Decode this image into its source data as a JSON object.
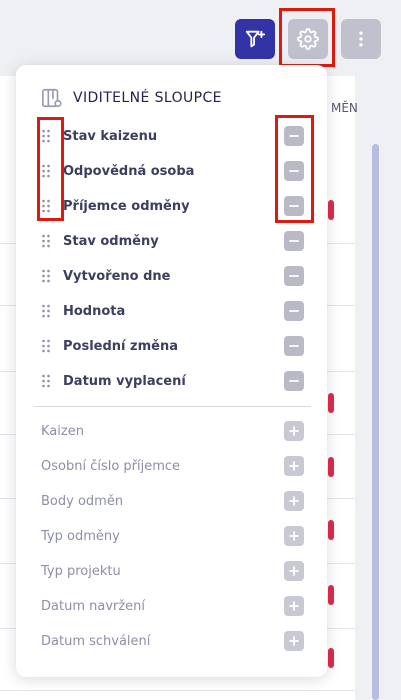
{
  "table": {
    "partial_header": "MĚN"
  },
  "toolbar": {
    "filter_icon": "filter-plus-icon",
    "settings_icon": "gear-icon",
    "more_icon": "more-vertical-icon"
  },
  "panel": {
    "title": "VIDITELNÉ SLOUPCE",
    "title_icon": "columns-settings-icon",
    "visible_columns": [
      {
        "label": "Stav kaizenu"
      },
      {
        "label": "Odpovědná osoba"
      },
      {
        "label": "Příjemce odměny"
      },
      {
        "label": "Stav odměny"
      },
      {
        "label": "Vytvořeno dne"
      },
      {
        "label": "Hodnota"
      },
      {
        "label": "Poslední změna"
      },
      {
        "label": "Datum vyplacení"
      }
    ],
    "hidden_columns": [
      {
        "label": "Kaizen"
      },
      {
        "label": "Osobní číslo příjemce"
      },
      {
        "label": "Body odměn"
      },
      {
        "label": "Typ odměny"
      },
      {
        "label": "Typ projektu"
      },
      {
        "label": "Datum navržení"
      },
      {
        "label": "Datum schválení"
      }
    ]
  },
  "colors": {
    "accent": "#3333a8",
    "highlight": "#e0190f",
    "status_marker": "#e0294a"
  }
}
